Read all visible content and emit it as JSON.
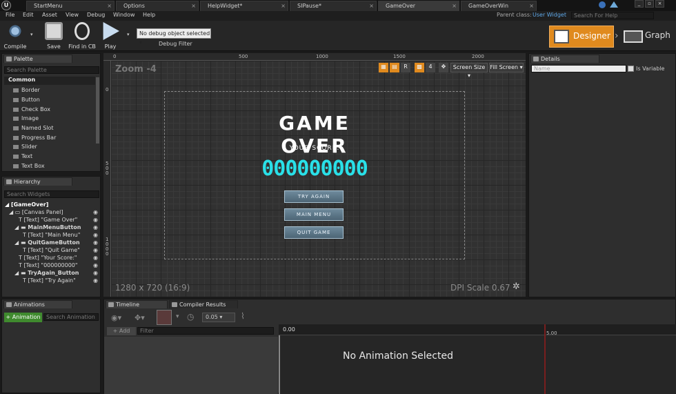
{
  "tabs": [
    "StartMenu",
    "Options",
    "HelpWidget*",
    "SIPause*",
    "GameOver",
    "GameOverWin"
  ],
  "parent_class_label": "Parent class:",
  "parent_class_value": "User Widget",
  "help_search_placeholder": "Search For Help",
  "menu": [
    "File",
    "Edit",
    "Asset",
    "View",
    "Debug",
    "Window",
    "Help"
  ],
  "toolbar": {
    "compile": "Compile",
    "save": "Save",
    "find_in_cb": "Find in CB",
    "play": "Play",
    "debug_object": "No debug object selected",
    "debug_filter": "Debug Filter",
    "designer": "Designer",
    "graph": "Graph"
  },
  "palette": {
    "tab": "Palette",
    "search_placeholder": "Search Palette",
    "category": "Common",
    "items": [
      "Border",
      "Button",
      "Check Box",
      "Image",
      "Named Slot",
      "Progress Bar",
      "Slider",
      "Text",
      "Text Box"
    ]
  },
  "hierarchy": {
    "tab": "Hierarchy",
    "search_placeholder": "Search Widgets",
    "items": [
      "[GameOver]",
      "[Canvas Panel]",
      "[Text] \"Game Over\"",
      "MainMenuButton",
      "[Text] \"Main Menu\"",
      "QuitGameButton",
      "[Text] \"Quit Game\"",
      "[Text] \"Your Score:\"",
      "[Text] \"000000000\"",
      "TryAgain_Button",
      "[Text] \"Try Again\""
    ]
  },
  "canvas": {
    "zoom": "Zoom -4",
    "r_label": "R",
    "grid_value": "4",
    "screen_size": "Screen Size",
    "fill_screen": "Fill Screen",
    "resolution": "1280 x 720 (16:9)",
    "dpi": "DPI Scale 0.67",
    "ruler_top": [
      "0",
      "500",
      "1000",
      "1500",
      "2000"
    ],
    "ruler_left": [
      "0",
      "5 0 0",
      "1 0 0 0"
    ]
  },
  "game": {
    "title": "GAME OVER",
    "score_label": "YOUR SCORE:",
    "score": "000000000",
    "buttons": [
      "TRY AGAIN",
      "MAIN MENU",
      "QUIT GAME"
    ]
  },
  "details": {
    "tab": "Details",
    "name_placeholder": "Name",
    "is_variable": "Is Variable"
  },
  "animations": {
    "tab": "Animations",
    "add_button": "+ Animation",
    "search_placeholder": "Search Animation"
  },
  "timeline": {
    "tab": "Timeline",
    "compiler_tab": "Compiler Results",
    "fps_value": "0.05",
    "add_label": "+ Add",
    "filter_placeholder": "Filter",
    "time_start": "0.00",
    "time_mark": "5.00",
    "empty_message": "No Animation Selected"
  },
  "colors": {
    "accent_orange": "#e08a1e",
    "score_cyan": "#29e0e8",
    "add_green": "#3f8a2e"
  }
}
